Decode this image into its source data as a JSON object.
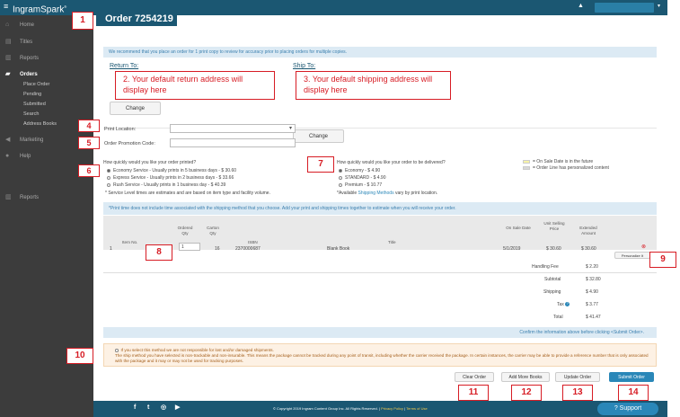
{
  "topbar": {
    "menu_icon": "hamburger-icon",
    "brand": "IngramSpark",
    "brand_mark": "®"
  },
  "sidebar": {
    "items": [
      {
        "label": "Home",
        "icon": "home-icon"
      },
      {
        "label": "Titles",
        "icon": "book-icon"
      },
      {
        "label": "Reports",
        "icon": "report-icon"
      },
      {
        "label": "Orders",
        "icon": "truck-icon"
      },
      {
        "label": "Marketing",
        "icon": "megaphone-icon"
      },
      {
        "label": "Help",
        "icon": "help-icon"
      },
      {
        "label": "Reports",
        "icon": "report-icon"
      }
    ],
    "orders_sub": [
      "Place Order",
      "Pending",
      "Submitted",
      "Search",
      "Address Books"
    ]
  },
  "page_title": "Order 7254219",
  "info_banner": "We recommend that you place an order for 1 print copy to review for accuracy prior to placing orders for multiple copies.",
  "return_to": {
    "label": "Return To:",
    "note": "2. Your default return address will display here",
    "button": "Change"
  },
  "ship_to": {
    "label": "Ship To:",
    "note": "3. Your default shipping address will display here",
    "button": "Change"
  },
  "print_location": {
    "label": "Print Location:",
    "value": ""
  },
  "promo": {
    "label": "Order Promotion Code:",
    "value": ""
  },
  "print_service": {
    "question": "How quickly would you like your order printed?",
    "options": [
      "Economy Service - Usually prints in 5 business days - $ 30.60",
      "Express Service - Usually prints in 2 business days - $ 33.66",
      "Rush Service - Usually prints in 1 business day - $ 40.39"
    ],
    "selected": 0,
    "footnote": "* Service Level times are estimates and are based on item type and facility volume."
  },
  "delivery": {
    "question": "How quickly would you like your order to be delivered?",
    "options": [
      "Economy - $ 4.90",
      "STANDARD - $ 4.90",
      "Premium - $ 10.77"
    ],
    "selected": 0,
    "footnote_pre": "*Available ",
    "footnote_link": "Shipping Methods",
    "footnote_post": " vary by print location."
  },
  "legend": {
    "items": [
      {
        "label": "= On Sale Date is in the future",
        "color": "#f7f3a8"
      },
      {
        "label": "= Order Line has personalized content",
        "color": "#d8d8d8"
      }
    ]
  },
  "print_time_note": "*Print time does not include time associated with the shipping method that you choose. Add your print and shipping times together to estimate when you will receive your order.",
  "table": {
    "headers": {
      "item_no": "Item No.",
      "ordered_qty": "Ordered Qty",
      "carton_qty": "Carton Qty",
      "isbn": "ISBN",
      "title": "Title",
      "on_sale": "On Sale Date",
      "unit_price": "Unit Selling Price",
      "extended": "Extended Amount"
    },
    "row": {
      "index": "1",
      "qty": "1",
      "carton": "16",
      "isbn": "2370000687",
      "title": "Blank Book",
      "on_sale": "5/1/2019",
      "unit_price": "$ 30.60",
      "extended": "$ 30.60",
      "personalize": "Personalize It"
    },
    "totals": [
      {
        "label": "Handling Fee",
        "value": "$ 2.20"
      },
      {
        "label": "Subtotal",
        "value": "$ 32.80"
      },
      {
        "label": "Shipping",
        "value": "$ 4.90"
      },
      {
        "label": "Tax",
        "value": "$ 3.77"
      },
      {
        "label": "Total",
        "value": "$ 41.47"
      }
    ]
  },
  "confirm_text": "Confirm the information above before clicking <Submit Order>.",
  "warning": {
    "line1": "If you select this method we are not responsible for lost and/or damaged shipments.",
    "line2": "The ship method you have selected is non-trackable and non-insurable. This means the package cannot be tracked during any point of transit, including whether the carrier received the package. In certain instances, the carrier may be able to provide a reference number that is only associated with the package and it may or may not be used for tracking purposes."
  },
  "buttons": {
    "clear": "Clear Order",
    "add": "Add More Books",
    "update": "Update Order",
    "submit": "Submit Order"
  },
  "callouts": {
    "c1": "1",
    "c4": "4",
    "c5": "5",
    "c6": "6",
    "c7": "7",
    "c8": "8",
    "c9": "9",
    "c10": "10",
    "c11": "11",
    "c12": "12",
    "c13": "13",
    "c14": "14"
  },
  "footer": {
    "copyright": "© Copyright 2019 Ingram Content Group Inc. All Rights Reserved.",
    "sep": " | ",
    "privacy": "Privacy Policy",
    "terms": "Terms of Use",
    "support": "Support"
  },
  "colors": {
    "header": "#1b5772",
    "sidebar": "#3c3c3c",
    "accent": "#2a87b8",
    "callout": "#d71c24"
  }
}
